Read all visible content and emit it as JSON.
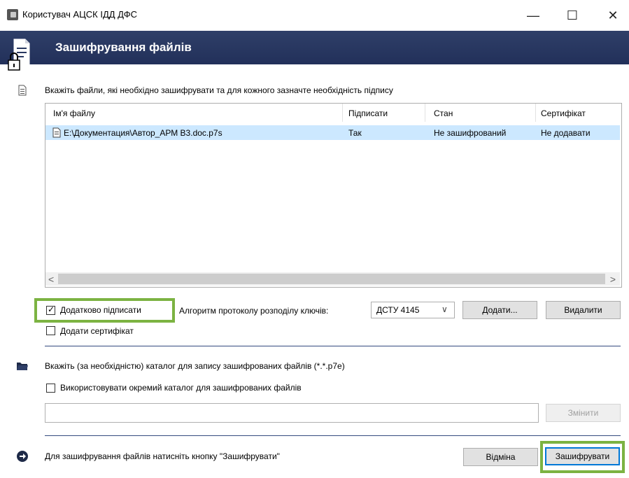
{
  "window": {
    "title": "Користувач АЦСК ІДД ДФС",
    "minimize": "—",
    "maximize": "☐",
    "close": "✕"
  },
  "header": {
    "title": "Зашифрування файлів"
  },
  "files_section": {
    "instruction": "Вкажіть файли, які необхідно зашифрувати та для кожного зазначте необхідність підпису",
    "columns": [
      "Ім'я файлу",
      "Підписати",
      "Стан",
      "Сертифікат"
    ],
    "rows": [
      {
        "file": "E:\\Документация\\Автор_АРМ В3.doc.p7s",
        "sign": "Так",
        "state": "Не зашифрований",
        "cert": "Не додавати"
      }
    ],
    "scroll_left": "<",
    "scroll_right": ">"
  },
  "options": {
    "sign_additionally": "Додатково підписати",
    "sign_additionally_checked": true,
    "add_certificate": "Додати сертифікат",
    "add_certificate_checked": false,
    "algorithm_label": "Алгоритм протоколу розподілу ключів:",
    "algorithm_value": "ДСТУ 4145",
    "add_button": "Додати...",
    "delete_button": "Видалити"
  },
  "output_section": {
    "instruction": "Вкажіть (за необхідністю) каталог для запису зашифрованих файлів (*.*.p7e)",
    "separate_dir_label": "Використовувати окремий каталог для зашифрованих файлів",
    "separate_dir_checked": false,
    "path_value": "",
    "change_button": "Змінити"
  },
  "footer": {
    "hint": "Для зашифрування файлів натисніть кнопку \"Зашифрувати\"",
    "cancel_button": "Відміна",
    "encrypt_button": "Зашифрувати"
  },
  "colors": {
    "header_bg": "#2a3961",
    "selection": "#cce8ff",
    "highlight": "#7cb342",
    "separator": "#344a7e"
  }
}
